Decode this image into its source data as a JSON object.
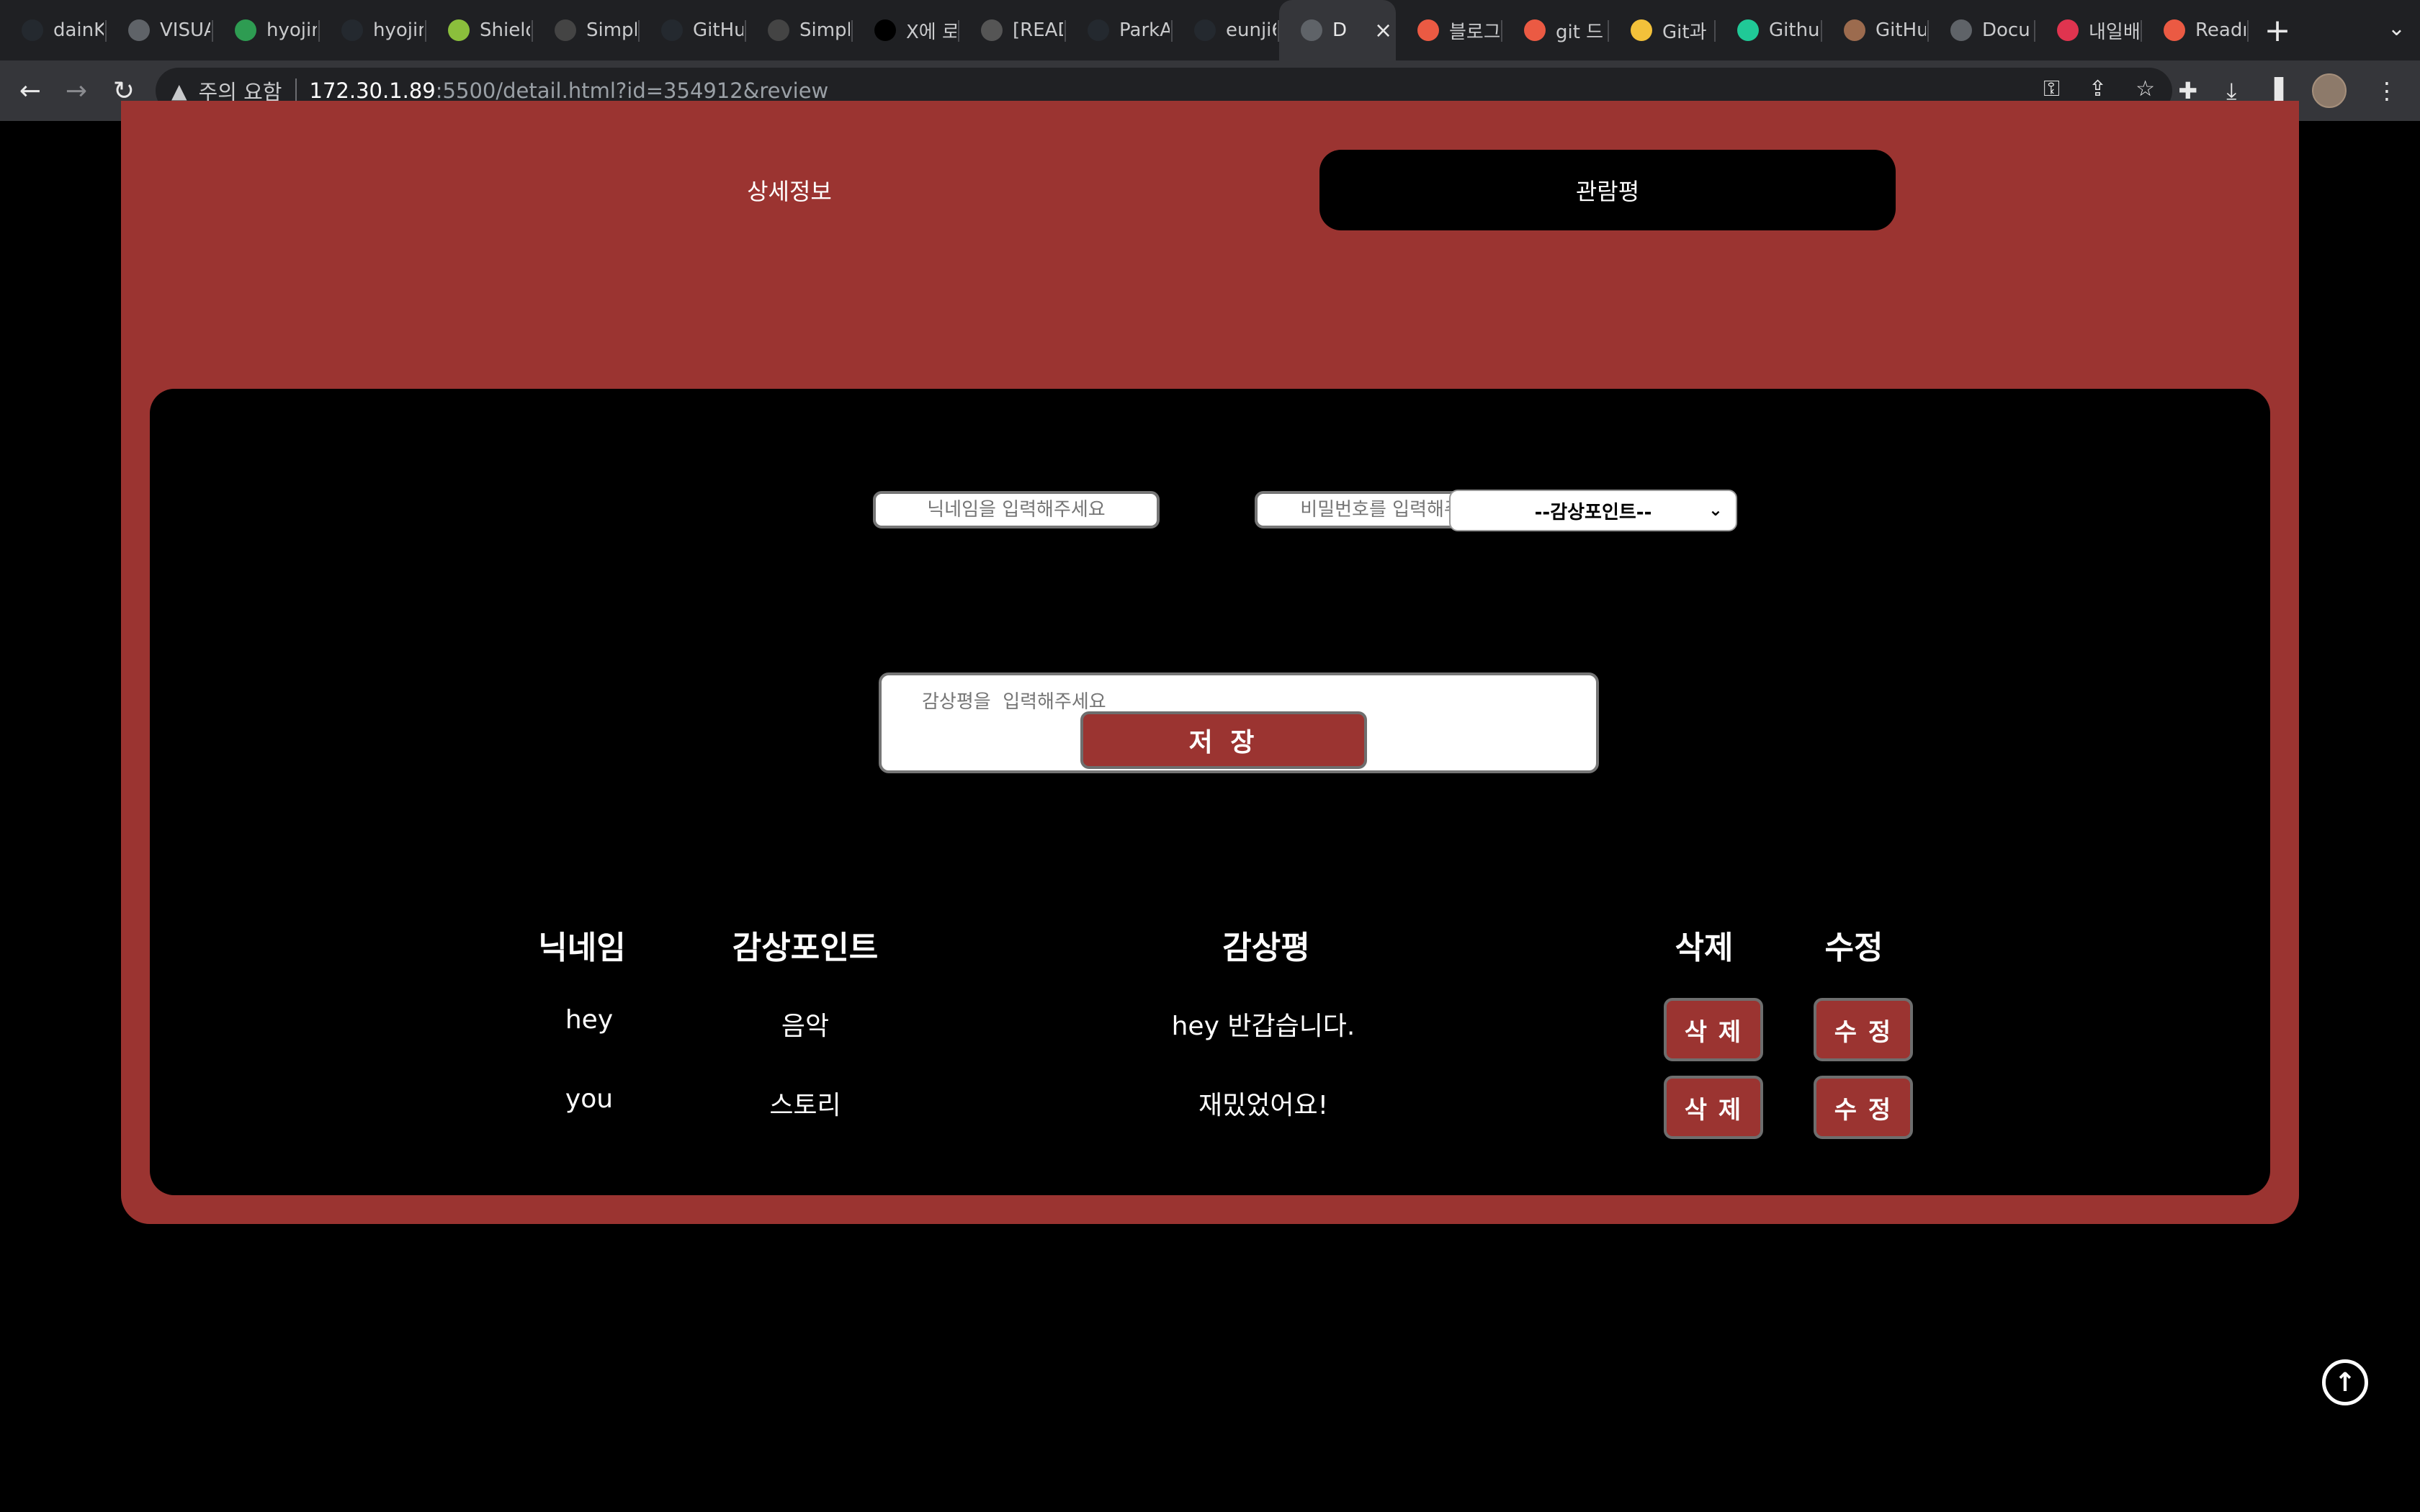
{
  "browser": {
    "tabs": [
      {
        "label": "dainK",
        "icon": "github-icon",
        "color": "#24292f"
      },
      {
        "label": "VISUA",
        "icon": "globe-icon",
        "color": "#5f6368"
      },
      {
        "label": "hyojin",
        "icon": "mail-icon",
        "color": "#2e9c52"
      },
      {
        "label": "hyojin",
        "icon": "github-icon",
        "color": "#24292f"
      },
      {
        "label": "Shield",
        "icon": "shield-icon",
        "color": "#8bbf3c"
      },
      {
        "label": "Simpl",
        "icon": "dollar-icon",
        "color": "#444"
      },
      {
        "label": "GitHu",
        "icon": "github-icon",
        "color": "#24292f"
      },
      {
        "label": "Simpl",
        "icon": "dollar-icon",
        "color": "#444"
      },
      {
        "label": "X에 로",
        "icon": "x-icon",
        "color": "#000"
      },
      {
        "label": "[READ",
        "icon": "doc-icon",
        "color": "#555"
      },
      {
        "label": "ParkA",
        "icon": "github-icon",
        "color": "#24292f"
      },
      {
        "label": "eunji6",
        "icon": "github-icon",
        "color": "#24292f"
      },
      {
        "label": "D",
        "icon": "globe-icon",
        "color": "#5f6368",
        "active": true
      },
      {
        "label": "블로그",
        "icon": "tistory-icon",
        "color": "#eb5a43"
      },
      {
        "label": "git 드",
        "icon": "tistory-icon",
        "color": "#eb5a43"
      },
      {
        "label": "Git과 (",
        "icon": "chick-icon",
        "color": "#f3c13a"
      },
      {
        "label": "Githu",
        "icon": "velog-icon",
        "color": "#20c997"
      },
      {
        "label": "GitHu",
        "icon": "avatar-icon",
        "color": "#9c6b4e"
      },
      {
        "label": "Docu",
        "icon": "globe-icon",
        "color": "#5f6368"
      },
      {
        "label": "내일배",
        "icon": "heart-icon",
        "color": "#e0344f"
      },
      {
        "label": "Readr",
        "icon": "tistory-icon",
        "color": "#eb5a43"
      }
    ],
    "new_tab": "+",
    "tab_menu": "⌄",
    "warning_text": "주의 요함",
    "url_host": "172.30.1.89",
    "url_rest": ":5500/detail.html?id=354912&review"
  },
  "page": {
    "tab_detail": "상세정보",
    "tab_review": "관람평",
    "form": {
      "nickname_placeholder": "닉네임을 입력해주세요",
      "password_placeholder": "비밀번호를 입력해주세요",
      "point_select": "--감상포인트--",
      "review_placeholder": "감상평을  입력해주세요",
      "save_label": "저 장"
    },
    "table": {
      "headers": [
        "닉네임",
        "감상포인트",
        "감상평",
        "삭제",
        "수정"
      ],
      "rows": [
        {
          "nickname": "hey",
          "point": "음악",
          "review": "hey 반갑습니다.",
          "delete": "삭 제",
          "edit": "수 정"
        },
        {
          "nickname": "you",
          "point": "스토리",
          "review": "재밌었어요!",
          "delete": "삭 제",
          "edit": "수 정"
        }
      ]
    }
  },
  "colors": {
    "accent_red": "#9b3431",
    "background": "#000000"
  }
}
